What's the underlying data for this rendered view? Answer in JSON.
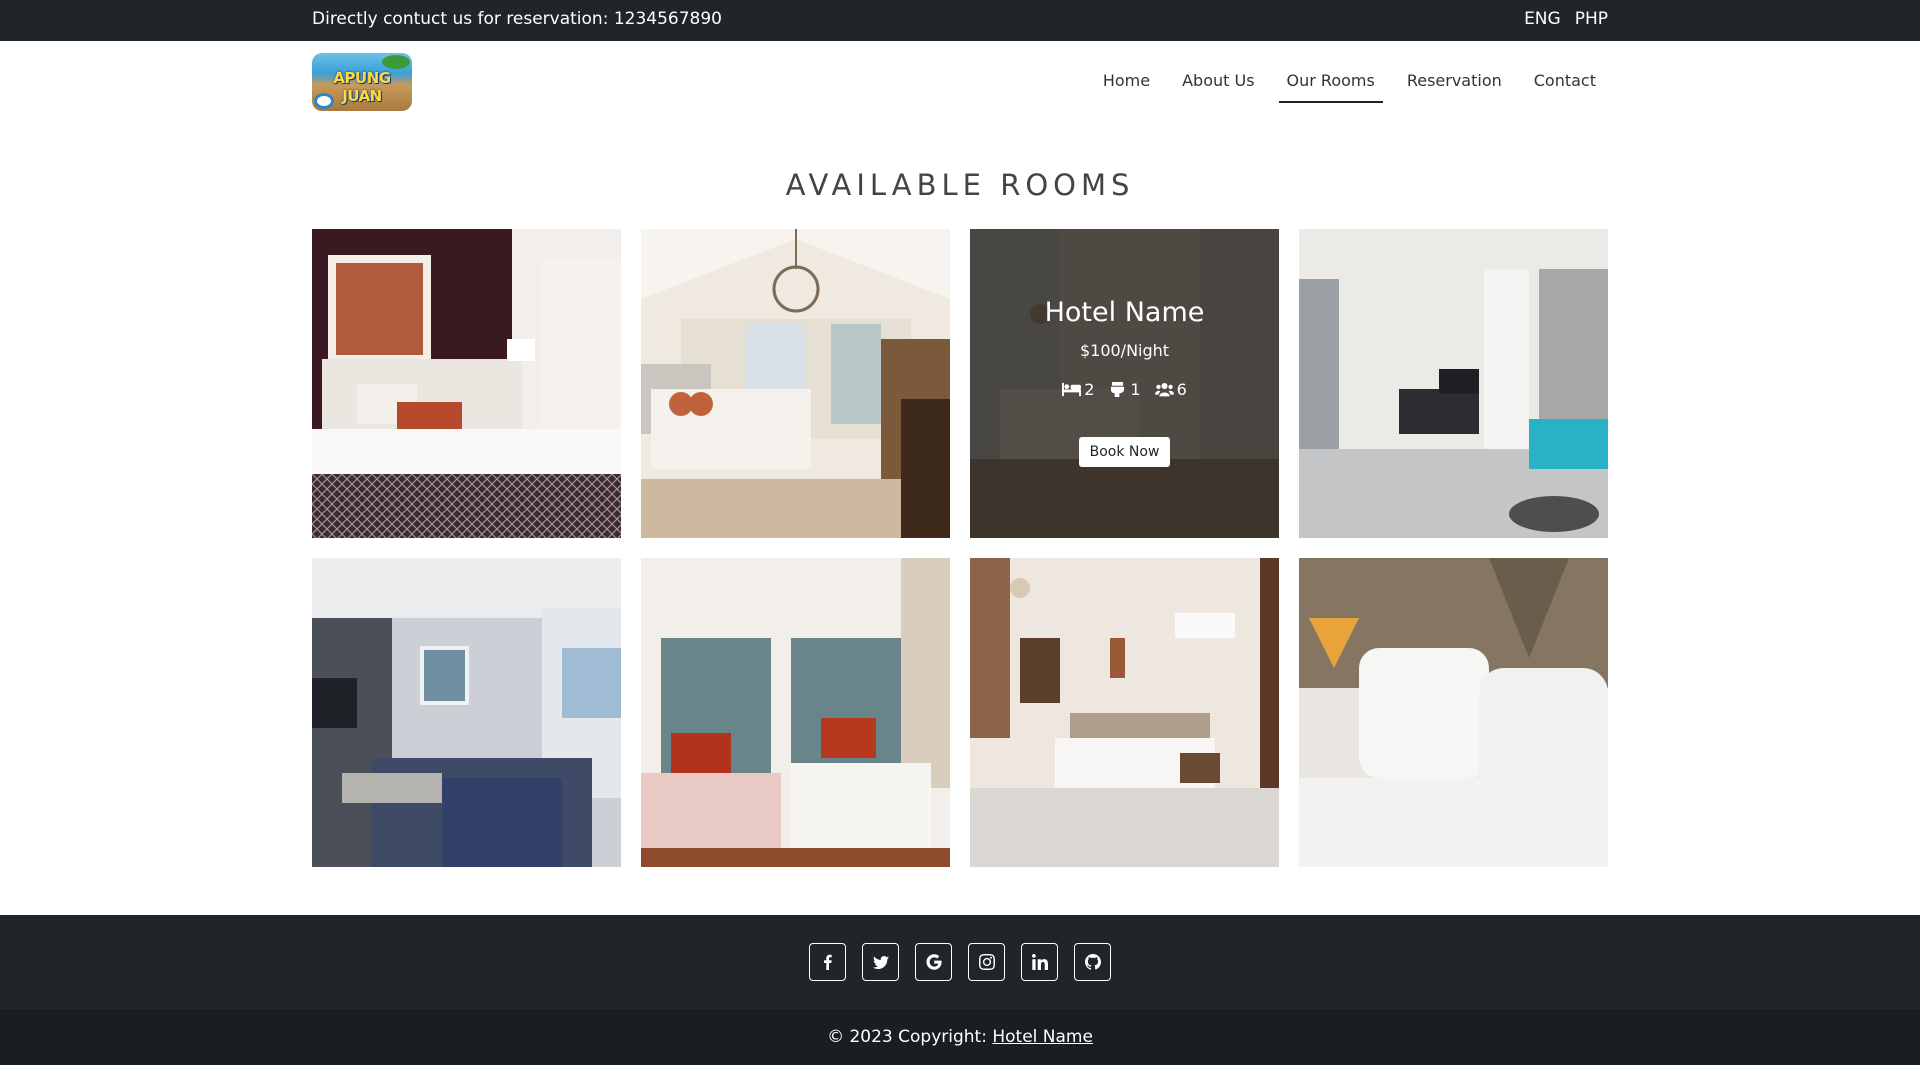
{
  "topbar": {
    "contact_text": "Directly contuct us for reservation: 1234567890",
    "lang": "ENG",
    "currency": "PHP"
  },
  "nav": {
    "logo_text": "APUNG JUAN",
    "items": [
      "Home",
      "About Us",
      "Our Rooms",
      "Reservation",
      "Contact"
    ],
    "active": "Our Rooms"
  },
  "section": {
    "title": "AVAILABLE ROOMS"
  },
  "hover_card": {
    "name": "Hotel Name",
    "price": "$100/Night",
    "beds": "2",
    "baths": "1",
    "guests": "6",
    "button": "Book Now"
  },
  "footer": {
    "social_icons": [
      "facebook-icon",
      "twitter-icon",
      "google-icon",
      "instagram-icon",
      "linkedin-icon",
      "github-icon"
    ],
    "copyright_prefix": "© 2023 Copyright: ",
    "copyright_link": "Hotel Name"
  },
  "colors": {
    "dark": "#212529",
    "darker": "#1b1e21",
    "white": "#ffffff"
  }
}
